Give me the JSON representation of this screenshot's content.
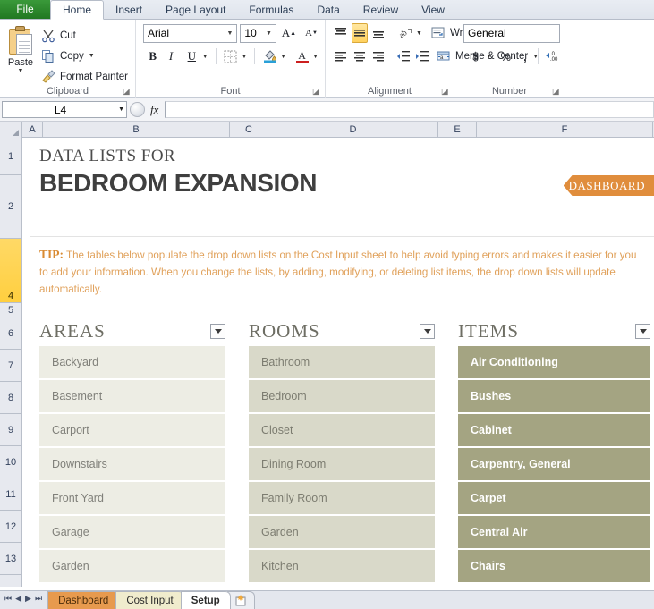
{
  "app": {
    "ribbon_tabs": [
      "File",
      "Home",
      "Insert",
      "Page Layout",
      "Formulas",
      "Data",
      "Review",
      "View"
    ],
    "active_ribbon_tab": "Home"
  },
  "ribbon": {
    "clipboard": {
      "group_label": "Clipboard",
      "paste_label": "Paste",
      "cut_label": "Cut",
      "copy_label": "Copy",
      "format_painter_label": "Format Painter"
    },
    "font": {
      "group_label": "Font",
      "font_name": "Arial",
      "font_size": "10",
      "grow_font": "A",
      "shrink_font": "A",
      "bold": "B",
      "italic": "I",
      "underline": "U"
    },
    "alignment": {
      "group_label": "Alignment",
      "wrap_text_label": "Wrap Text",
      "merge_center_label": "Merge & Center"
    },
    "number": {
      "group_label": "Number",
      "format": "General",
      "currency": "$",
      "percent": "%",
      "comma": ","
    }
  },
  "formula_bar": {
    "name_box": "L4",
    "formula": ""
  },
  "grid": {
    "columns": [
      "A",
      "B",
      "C",
      "D",
      "E",
      "F"
    ],
    "rows": [
      "1",
      "2",
      "4",
      "5",
      "6",
      "7",
      "8",
      "9",
      "10",
      "11",
      "12",
      "13"
    ],
    "selected_row": "4"
  },
  "sheet": {
    "kicker": "DATA LISTS FOR",
    "title": "BEDROOM EXPANSION",
    "dashboard_badge": "DASHBOARD",
    "tip_prefix": "TIP:",
    "tip_text": " The tables below populate the drop down lists on the Cost Input sheet to help avoid typing errors and makes it easier for you to add your information. When you change the lists, by adding, modifying, or deleting list items, the drop down lists will update automatically.",
    "tables": [
      {
        "header": "AREAS",
        "color": "#edede4",
        "items": [
          "Backyard",
          "Basement",
          "Carport",
          "Downstairs",
          "Front Yard",
          "Garage",
          "Garden"
        ]
      },
      {
        "header": "ROOMS",
        "color": "#d9d9c9",
        "items": [
          "Bathroom",
          "Bedroom",
          "Closet",
          "Dining Room",
          "Family Room",
          "Garden",
          "Kitchen"
        ]
      },
      {
        "header": "ITEMS",
        "color": "#a4a482",
        "items": [
          "Air Conditioning",
          "Bushes",
          "Cabinet",
          "Carpentry, General",
          "Carpet",
          "Central Air",
          "Chairs"
        ]
      }
    ]
  },
  "sheet_tabs": {
    "tabs": [
      "Dashboard",
      "Cost Input",
      "Setup"
    ],
    "active": "Setup",
    "nav_first": "⏮",
    "nav_prev": "◀",
    "nav_next": "▶",
    "nav_last": "⏭"
  }
}
